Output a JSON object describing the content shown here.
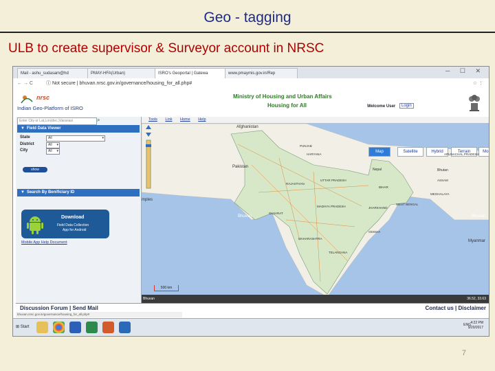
{
  "slide": {
    "title": "Geo - tagging",
    "subtitle": "ULB to create supervisor & Surveyor account in NRSC",
    "page_number": "7"
  },
  "browser": {
    "tabs": [
      "Mail - ashu_sudasam@hd",
      "PMAY-HFA(Urban)",
      "ISRO's Geoportal | Gatewa",
      "www.pmaymis.gov.in/Rep"
    ],
    "url_security": "Not secure",
    "url": "bhuvan.nrsc.gov.in/governance/housing_for_all.php#"
  },
  "site_header": {
    "logo_name": "nrsc",
    "logo_tagline": "Indian Geo-Platform of ISRO",
    "ministry": "Ministry of Housing and Urban Affairs",
    "program": "Housing for All",
    "welcome": "Welcome User",
    "login_label": "Login"
  },
  "left_panel": {
    "search_placeholder": "Enter City or Lat,Lon(dec.)Varanasi",
    "field_viewer_title": "Field Data Viewer",
    "fields": [
      {
        "label": "State",
        "value": "All"
      },
      {
        "label": "District",
        "value": "All"
      },
      {
        "label": "City",
        "value": "All"
      }
    ],
    "show_label": "show",
    "beneficiary_title": "Search By Benificiary ID",
    "download_title": "Download",
    "download_sub1": "Field Data Collection",
    "download_sub2": "App for Android",
    "help_link": "Mobile App Help Document"
  },
  "map": {
    "tools": [
      "Tools",
      "Link",
      "Home",
      "Help"
    ],
    "map_types": [
      "Map",
      "Satellite",
      "Hybrid",
      "Terrain",
      "More"
    ],
    "active_type": "Map",
    "labels": [
      "Afghanistan",
      "Pakistan",
      "Nepal",
      "Myanmar",
      "Bhutan",
      "PUNJAB",
      "HARYANA",
      "UTTAR PRADESH",
      "RAJASTHAN",
      "GUJARAT",
      "MADHYA PRADESH",
      "MAHARASHTRA",
      "TELANGANA",
      "ODISHA",
      "BIHAR",
      "JHARKHAND",
      "WEST BENGAL",
      "ASSAM",
      "MEGHALAYA",
      "ARUNACHAL PRADESH"
    ],
    "scale_label": "500 km",
    "watermark": "Bhuvan",
    "coords": "36.52, 33.63",
    "side_label": "mples"
  },
  "footer": {
    "left": "Discussion Forum | Send Mail",
    "right": "Contact us | Disclaimer",
    "status_url": "bhuvan.nrsc.gov.in/governance/housing_for_all.php#"
  },
  "taskbar": {
    "start": "Start",
    "tray_text": "ENG",
    "time": "4:22 PM",
    "date": "9/20/2017"
  }
}
